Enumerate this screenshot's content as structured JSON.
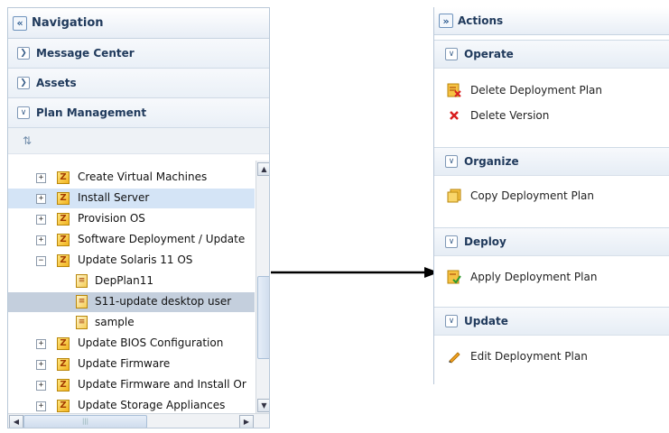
{
  "navigation": {
    "title": "Navigation",
    "collapse_glyph": "«",
    "sections": {
      "message_center": "Message Center",
      "assets": "Assets",
      "plan_management": "Plan Management"
    },
    "toolbar_icon": "refresh-icon",
    "tree": [
      {
        "label": "Create Virtual Machines",
        "expander": "+",
        "icon": "profile-icon",
        "level": 0,
        "state": "normal"
      },
      {
        "label": "Install Server",
        "expander": "+",
        "icon": "profile-icon",
        "level": 0,
        "state": "hover"
      },
      {
        "label": "Provision OS",
        "expander": "+",
        "icon": "profile-icon",
        "level": 0,
        "state": "normal"
      },
      {
        "label": "Software Deployment / Update",
        "expander": "+",
        "icon": "profile-icon",
        "level": 0,
        "state": "normal"
      },
      {
        "label": "Update Solaris 11 OS",
        "expander": "−",
        "icon": "profile-icon",
        "level": 0,
        "state": "normal"
      },
      {
        "label": "DepPlan11",
        "expander": "",
        "icon": "deployment-plan-icon",
        "level": 1,
        "state": "normal"
      },
      {
        "label": "S11-update desktop user",
        "expander": "",
        "icon": "deployment-plan-icon",
        "level": 1,
        "state": "selected"
      },
      {
        "label": "sample",
        "expander": "",
        "icon": "deployment-plan-icon",
        "level": 1,
        "state": "normal"
      },
      {
        "label": "Update BIOS Configuration",
        "expander": "+",
        "icon": "profile-icon",
        "level": 0,
        "state": "normal"
      },
      {
        "label": "Update Firmware",
        "expander": "+",
        "icon": "profile-icon",
        "level": 0,
        "state": "normal"
      },
      {
        "label": "Update Firmware and Install Or",
        "expander": "+",
        "icon": "profile-icon",
        "level": 0,
        "state": "normal"
      },
      {
        "label": "Update Storage Appliances",
        "expander": "+",
        "icon": "profile-icon",
        "level": 0,
        "state": "normal"
      }
    ],
    "scroll_glyphs": {
      "up": "▲",
      "down": "▼",
      "left": "◀",
      "right": "▶",
      "thumb_grip": "|||"
    }
  },
  "actions": {
    "title": "Actions",
    "expand_glyph": "»",
    "sections": [
      {
        "header": "Operate",
        "items": [
          {
            "label": "Delete Deployment Plan",
            "icon": "delete-plan-icon"
          },
          {
            "label": "Delete Version",
            "icon": "red-x-icon"
          }
        ]
      },
      {
        "header": "Organize",
        "items": [
          {
            "label": "Copy Deployment Plan",
            "icon": "copy-plan-icon"
          }
        ]
      },
      {
        "header": "Deploy",
        "items": [
          {
            "label": "Apply Deployment Plan",
            "icon": "apply-plan-icon"
          }
        ]
      },
      {
        "header": "Update",
        "items": [
          {
            "label": "Edit Deployment Plan",
            "icon": "pencil-icon"
          }
        ]
      }
    ]
  },
  "colors": {
    "selected_row": "#c4cfdd",
    "hover_row": "#d4e4f6",
    "header_text": "#203a5c",
    "delete_red": "#d81e1e"
  }
}
